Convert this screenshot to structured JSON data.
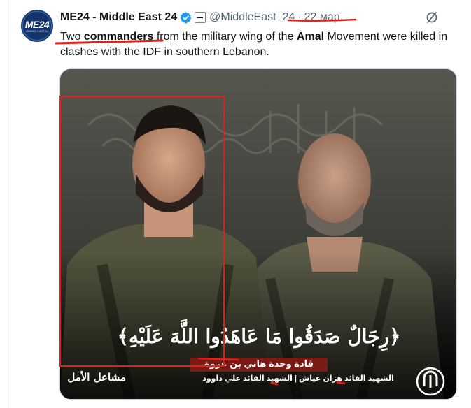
{
  "account": {
    "name": "ME24 - Middle East 24",
    "handle": "@MiddleEast_24",
    "separator": "·",
    "timestamp": "22 мар.",
    "avatar_text": "ME24",
    "avatar_subtext": "MIDDLE EAST 24"
  },
  "tweet": {
    "t1": "Two ",
    "t2": "commanders",
    "t3": " from the military wing of the ",
    "t4": "Amal",
    "t5": " Movement were killed in clashes with the IDF in southern Lebanon."
  },
  "media": {
    "calligraphy": "﴿رِجَالٌ صَدَقُوا مَا عَاهَدُوا اللَّهَ عَلَيْهِ﴾",
    "subtitle": "قادة وحدة هاني بن عروة",
    "names": "الشهيد القائد هزان عياش | الشهيد القائد علي داوود",
    "logo_left": "مشاعل الأمل"
  },
  "icons": [
    "verified-badge-icon",
    "affiliate-badge-icon",
    "grok-more-icon",
    "movement-logo-icon"
  ],
  "colors": {
    "verified": "#1d9bf0",
    "annotation_red": "#e0201b",
    "muted_text": "#536471"
  }
}
